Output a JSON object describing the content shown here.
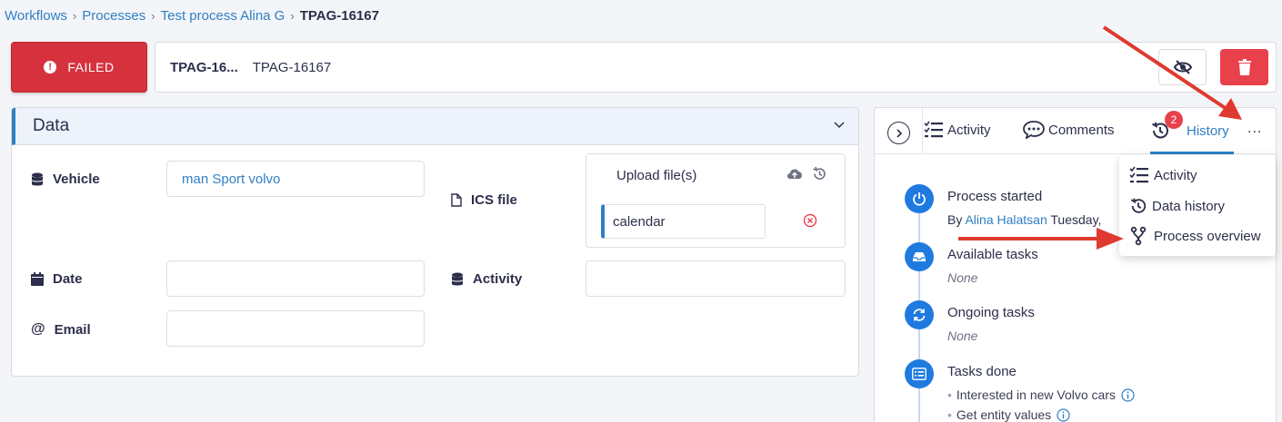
{
  "breadcrumb": {
    "items": [
      "Workflows",
      "Processes",
      "Test process Alina G"
    ],
    "current": "TPAG-16167",
    "separator": "›"
  },
  "status": {
    "label": "FAILED",
    "color": "#d6323e"
  },
  "title_bar": {
    "short_id": "TPAG-16...",
    "full_id": "TPAG-16167"
  },
  "data_panel": {
    "title": "Data",
    "fields": {
      "vehicle": {
        "label": "Vehicle",
        "value": "man Sport volvo"
      },
      "ics_file": {
        "label": "ICS file",
        "upload_label": "Upload file(s)",
        "file_name": "calendar"
      },
      "date": {
        "label": "Date",
        "value": ""
      },
      "activity": {
        "label": "Activity",
        "value": ""
      },
      "email": {
        "label": "Email",
        "value": ""
      }
    }
  },
  "side_panel": {
    "tabs": [
      {
        "label": "Activity",
        "icon": "list-check-icon"
      },
      {
        "label": "Comments",
        "icon": "comment-dots-icon"
      },
      {
        "label": "History",
        "icon": "history-icon",
        "badge": "2",
        "active": true
      }
    ],
    "more_label": "...",
    "timeline": {
      "process_started": {
        "title": "Process started",
        "by_prefix": "By",
        "user": "Alina Halatsan",
        "when": "Tuesday,"
      },
      "available_tasks": {
        "title": "Available tasks",
        "value": "None"
      },
      "ongoing_tasks": {
        "title": "Ongoing tasks",
        "value": "None"
      },
      "tasks_done": {
        "title": "Tasks done",
        "items": [
          "Interested in new Volvo cars",
          "Get entity values"
        ]
      }
    }
  },
  "dropdown": {
    "items": [
      {
        "label": "Activity",
        "icon": "list-check-icon"
      },
      {
        "label": "Data history",
        "icon": "history-icon"
      },
      {
        "label": "Process overview",
        "icon": "branch-icon"
      }
    ]
  },
  "colors": {
    "accent": "#2f7fc4",
    "danger": "#e8414b",
    "arrow": "#e0392f",
    "timeline_node": "#1f7ae0"
  }
}
